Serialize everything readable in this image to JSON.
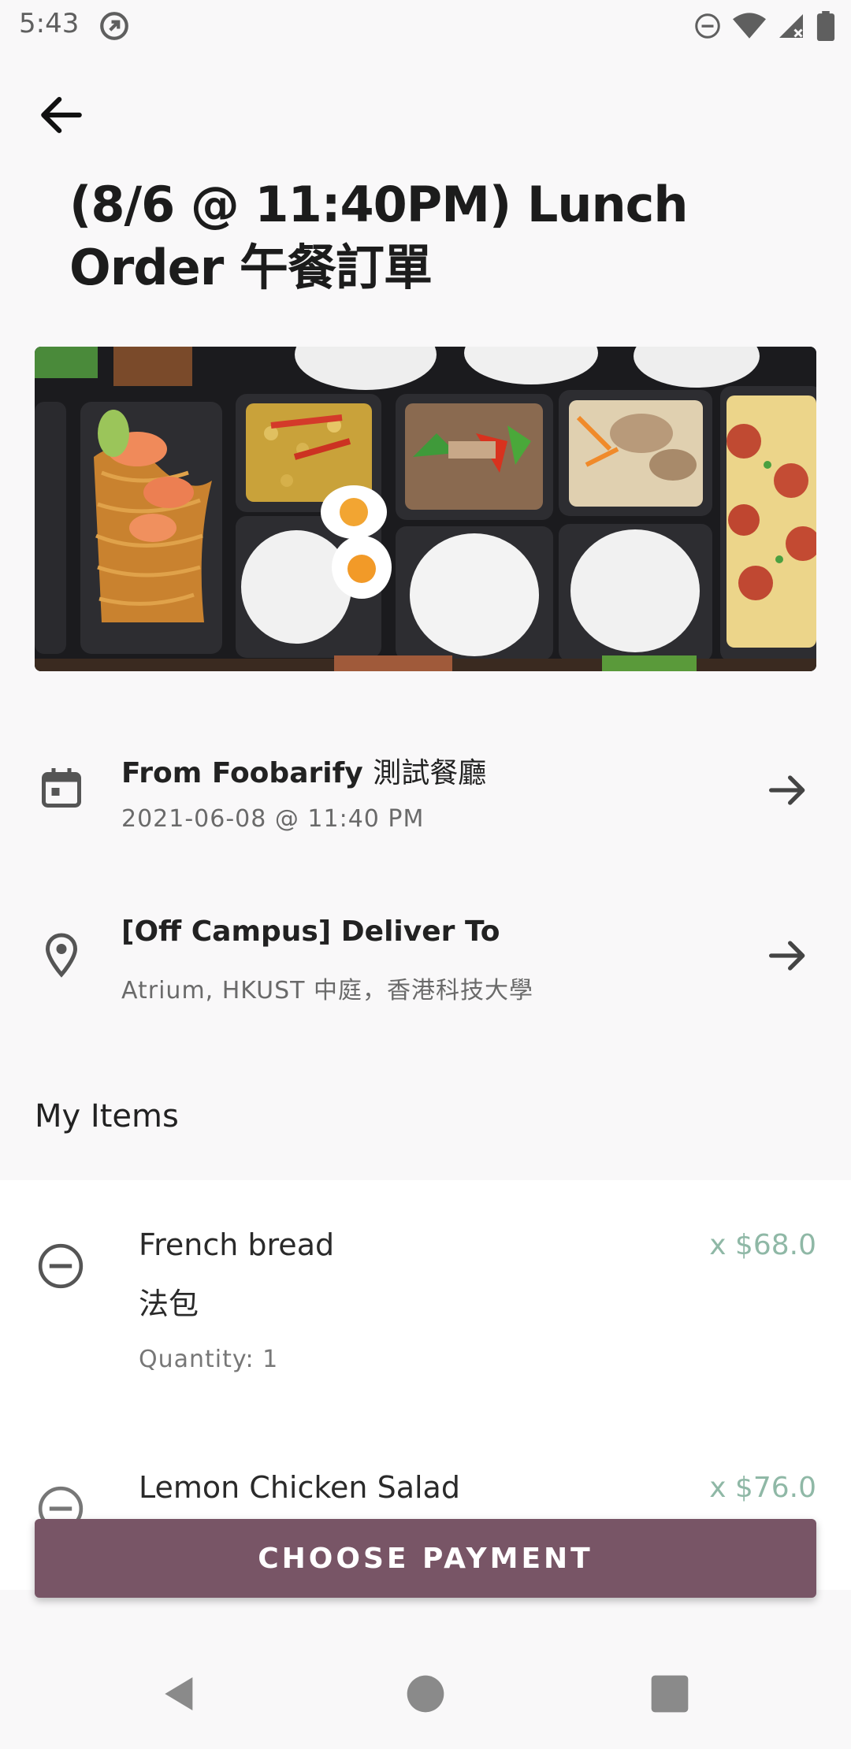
{
  "status_bar": {
    "time": "5:43"
  },
  "page": {
    "title": "(8/6 @ 11:40PM) Lunch Order 午餐訂單"
  },
  "restaurant": {
    "title_prefix": "From Foobarify",
    "title_cjk": "測試餐廳",
    "datetime": "2021-06-08 @ 11:40 PM"
  },
  "delivery": {
    "title": "[Off Campus] Deliver To",
    "address": "Atrium, HKUST 中庭，香港科技大學"
  },
  "items_section": {
    "title": "My Items",
    "items": [
      {
        "name": "French bread",
        "name_cjk": "法包",
        "price": "x $68.0",
        "quantity": "Quantity: 1"
      },
      {
        "name": "Lemon Chicken Salad",
        "price": "x $76.0"
      }
    ]
  },
  "actions": {
    "choose_payment": "CHOOSE PAYMENT"
  },
  "colors": {
    "accent": "#785566",
    "price": "#8fb8a6"
  },
  "icons": [
    "at-icon",
    "dnd-icon",
    "wifi-icon",
    "signal-icon",
    "battery-icon",
    "back-arrow-icon",
    "calendar-icon",
    "location-pin-icon",
    "arrow-right-icon",
    "remove-circle-icon"
  ]
}
